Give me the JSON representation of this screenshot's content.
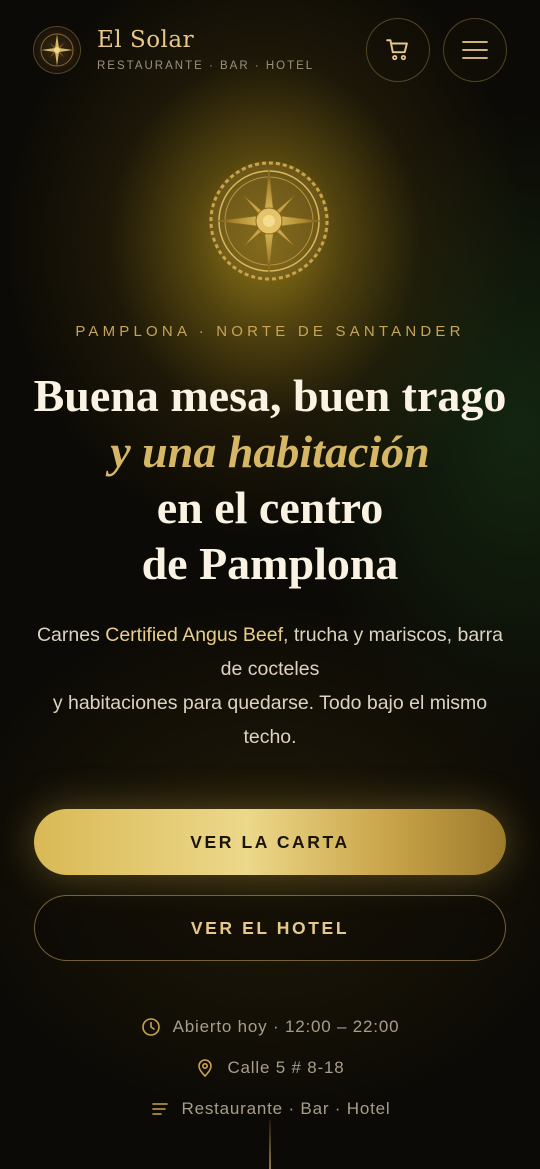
{
  "brand": {
    "name": "El Solar",
    "tagline": "RESTAURANTE · BAR · HOTEL"
  },
  "header": {
    "cart_icon": "cart-icon",
    "menu_icon": "hamburger-menu-icon"
  },
  "hero": {
    "emblem_icon": "sun-compass-emblem-icon",
    "location": "PAMPLONA · NORTE DE SANTANDER",
    "headline_line1": "Buena mesa, buen trago",
    "headline_accent": "y una habitación",
    "headline_line3": "en el centro",
    "headline_line4": "de Pamplona",
    "desc_pre": "Carnes ",
    "desc_highlight": "Certified Angus Beef",
    "desc_mid": ", trucha y mariscos, barra de cocteles",
    "desc_post": "y habitaciones para quedarse. Todo bajo el mismo techo."
  },
  "actions": {
    "primary_label": "VER LA CARTA",
    "secondary_label": "VER EL HOTEL"
  },
  "info": {
    "hours": "Abierto hoy · 12:00 – 22:00",
    "address": "Calle 5 # 8-18",
    "services": "Restaurante · Bar · Hotel"
  },
  "colors": {
    "accent_gold": "#c9a449",
    "background": "#0c0a06"
  }
}
